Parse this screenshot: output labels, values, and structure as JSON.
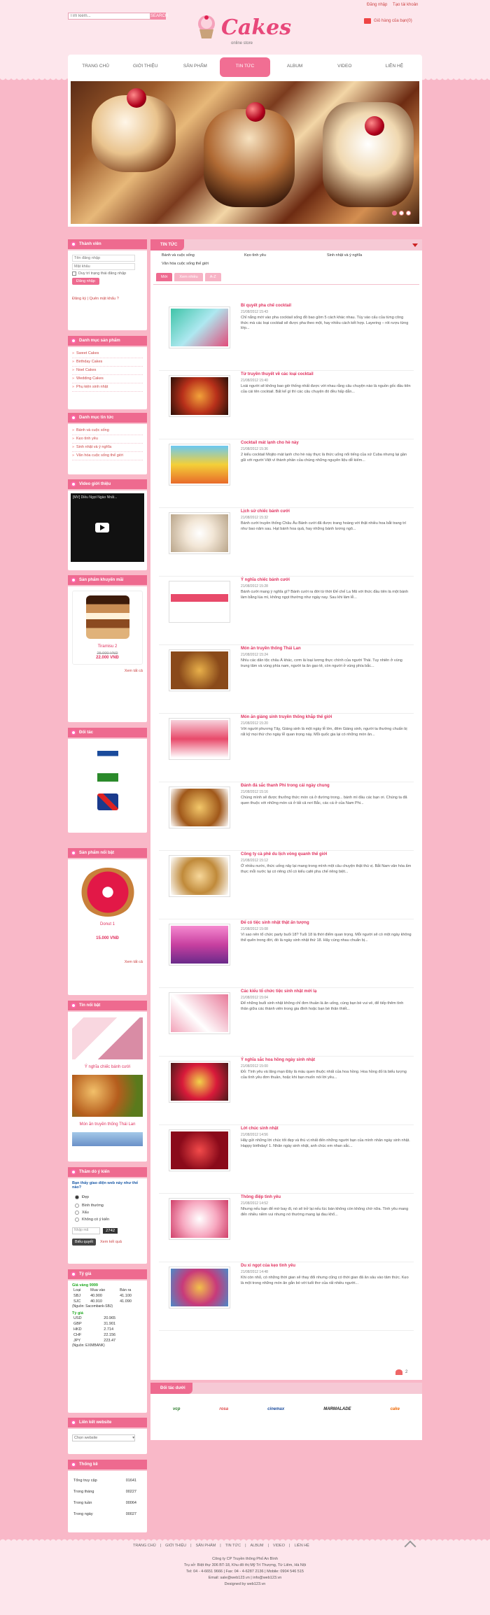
{
  "header": {
    "search_placeholder": "Tìm kiếm...",
    "search_button": "SEARCH",
    "login_link": "Đăng nhập",
    "register_link": "Tạo tài khoản",
    "cart_text": "Giỏ hàng của bạn(0)",
    "logo_word": "Cakes",
    "logo_sub": "online store"
  },
  "nav": [
    "TRANG CHỦ",
    "GIỚI THIỆU",
    "SẢN PHẨM",
    "TIN TỨC",
    "ALBUM",
    "VIDEO",
    "LIÊN HỆ"
  ],
  "nav_active": 3,
  "sidebar": {
    "login": {
      "title": "Thành viên",
      "username_ph": "Tên đăng nhập",
      "password_ph": "Mật khẩu",
      "remember": "Duy trì trạng thái đăng nhập",
      "button": "Đăng nhập",
      "links": "Đăng ký | Quên mật khẩu ?"
    },
    "products": {
      "title": "Danh mục sản phẩm",
      "items": [
        "Sweet Cakes",
        "Birthday Cakes",
        "Noel Cakes",
        "Wedding Cakes",
        "Phụ kiện sinh nhật"
      ]
    },
    "news": {
      "title": "Danh mục tin tức",
      "items": [
        "Bánh và cuộc sống",
        "Kẹo tình yêu",
        "Sinh nhật và ý nghĩa",
        "Văn hóa cuộc sống thế giới"
      ]
    },
    "video": {
      "title": "Video giới thiệu",
      "caption": "[MV] Diều Ngọt Ngào Nhất..."
    },
    "promo": {
      "title": "Sản phẩm khuyến mãi",
      "name": "Tiramisu 2",
      "old_price": "25.000 VNĐ",
      "new_price": "22.000 VNĐ",
      "more": "Xem tất cả"
    },
    "partners_title": "Đối tác",
    "featured": {
      "title": "Sản phẩm nổi bật",
      "name": "Donut 1",
      "price": "15.000 VNĐ",
      "more": "Xem tất cả"
    },
    "featured_news": {
      "title": "Tin nổi bật",
      "items": [
        "Ý nghĩa chiếc bánh cưới",
        "Món ăn truyền thống Thái Lan"
      ]
    },
    "poll": {
      "title": "Thăm dò ý kiến",
      "question": "Bạn thấy giao diện web này như thế nào?",
      "options": [
        "Đẹp",
        "Bình thường",
        "Xấu",
        "Không có ý kiến"
      ],
      "selected": 0,
      "code_label": "Nhập mã",
      "code": "2742",
      "vote_button": "Biểu quyết",
      "result_link": "Xem kết quả"
    },
    "rates": {
      "title": "Tỷ giá",
      "gold_label": "Giá vàng 9999",
      "gold_cols": [
        "Loại",
        "Mua vào",
        "Bán ra"
      ],
      "gold_rows": [
        [
          "SBJ",
          "40.900",
          "41.100"
        ],
        [
          "SJC",
          "40.910",
          "41.090"
        ]
      ],
      "gold_source": "(Nguồn: Sacombank-SBJ)",
      "fx_label": "Tỷ giá",
      "fx_rows": [
        [
          "USD",
          "20.965"
        ],
        [
          "GBP",
          "31.901"
        ],
        [
          "HKD",
          "2.714"
        ],
        [
          "CHF",
          "22.156"
        ],
        [
          "JPY",
          "223.47"
        ]
      ],
      "fx_source": "(Nguồn: EXIMBANK)"
    },
    "weblinks": {
      "title": "Liên kết website",
      "select": "Chọn website"
    },
    "stats": {
      "title": "Thống kê",
      "rows": [
        [
          "Tổng truy cập",
          "01641"
        ],
        [
          "Trong tháng",
          "00227"
        ],
        [
          "Trong tuần",
          "00064"
        ],
        [
          "Trong ngày",
          "00027"
        ]
      ]
    }
  },
  "main": {
    "title": "TIN TỨC",
    "cats": [
      "Bánh và cuộc sống",
      "Kẹo tình yêu",
      "Sinh nhật và ý nghĩa",
      "Văn hóa cuộc sống thế giới"
    ],
    "tabs": [
      "Mới",
      "Xem nhiều",
      "A-Z"
    ],
    "articles": [
      {
        "title": "Bí quyết pha chế cocktail",
        "date": "21/08/2012 15:43",
        "excerpt": "Chỉ nắng mới vào pha cocktail sống đồ bao gồm 5 cách khác nhau. Tùy vào cấu của từng công thức mà các loại cocktail sẽ được pha theo một, hay nhiều cách kết hợp. Layering – rót rượu từng lớp..."
      },
      {
        "title": "Từ truyền thuyết về các loại cocktail",
        "date": "21/08/2012 15:40",
        "excerpt": "Loài người sẽ không bao giờ thống nhất được với nhau rằng câu chuyện nào là nguồn gốc đầu tiên của cái tên cocktail. Bất kể gì thì các câu chuyện đó đều hấp dẫn..."
      },
      {
        "title": "Cocktail mát lạnh cho hè này",
        "date": "21/08/2012 15:36",
        "excerpt": "2 kiểu cocktail Mojito mát lạnh cho hè này thực là thức uống nổi tiếng của xứ Cuba nhưng lại gần gũi với người Việt vì thành phần của chúng những nguyên liệu dễ kiếm..."
      },
      {
        "title": "Lịch sử chiếc bánh cưới",
        "date": "21/08/2012 15:32",
        "excerpt": "Bánh cưới truyền thống Châu Âu Bánh cưới đã được trang hoàng với thật nhiều hoa bắt trang trí như bao năm sau. Hạt bánh hoa quả, hay những bánh lương ngô..."
      },
      {
        "title": "Ý nghĩa chiếc bánh cưới",
        "date": "21/08/2012 15:28",
        "excerpt": "Bánh cưới mang ý nghĩa gì? Bánh cưới ra đời từ thời Đế chế La Mã với thức đầu tiên là một bánh làm bằng lúa mì, không ngọt thường như ngày nay. Sau khi làm lễ..."
      },
      {
        "title": "Món ăn truyền thống Thái Lan",
        "date": "21/08/2012 15:24",
        "excerpt": "Nhìu các dân tộc châu Á khác, cơm là loại lương thực chính của người Thái. Tuy nhiên ở vùng trung tâm và vùng phía nam, người ta ăn gạo tẻ, còn người ở vùng phía bắc..."
      },
      {
        "title": "Món ăn giáng sinh truyền thống khắp thế giới",
        "date": "21/08/2012 15:20",
        "excerpt": "Với người phương Tây, Giáng sinh là một ngày lễ lớn, đêm Giáng sinh, người ta thường chuẩn bị rất kỹ mọi thứ cho ngày lễ quan trọng này. Mỗi quốc gia lại có những món ăn..."
      },
      {
        "title": "Đánh đá sắc thanh Phi trong cái ngày chung",
        "date": "21/08/2012 15:16",
        "excerpt": "Chúng mình sẽ được thưởng thức món cá ở đường trong... bánh mì đầu các bạn ơi. Chúng ta đã quen thuộc với những món cá ở tất cả nơi Bắc, các cá ở của Nam Phi..."
      },
      {
        "title": "Công ty cà phê du lịch vòng quanh thế giới",
        "date": "21/08/2012 15:12",
        "excerpt": "Ở nhiều nước, thức uống nây lại mang trong mình một câu chuyện thật thú vị. Bắt Nam văn hóa ẩm thực mỗi nước lại có riêng chỉ có kiểu café pha chế riêng biệt..."
      },
      {
        "title": "Để có tiệc sinh nhật thật ấn tượng",
        "date": "21/08/2012 15:08",
        "excerpt": "Vì sao nên tổ chức party buổi 18? Tuổi 18 là thời điểm quan trọng. Mỗi người sẽ có một ngày không thể quên trong đời, đó là ngày sinh nhật thứ 18. Hãy cùng nhau chuẩn bị..."
      },
      {
        "title": "Các kiểu tổ chức tiệc sinh nhật mới lạ",
        "date": "21/08/2012 15:04",
        "excerpt": "Để những buổi sinh nhật không chỉ đơn thuần là ăn uống, cùng bạn bè vui vẻ, để tiếp thêm tình thân giữa các thành viên trong gia đình hoặc bạn bè thân thiết..."
      },
      {
        "title": "Ý nghĩa sắc hoa hồng ngày sinh nhật",
        "date": "21/08/2012 15:00",
        "excerpt": "Đỏ: Tình yêu và lãng mạn Đây là màu quen thuộc nhất của hoa hồng. Hoa hồng đỏ là biểu tượng của tình yêu đơn thuần, hoặc khi bạn muốn nói lời yêu..."
      },
      {
        "title": "Lời chúc sinh nhật",
        "date": "21/08/2012 14:56",
        "excerpt": "Hãy gửi những lời chúc tốt đẹp và thú vị nhất đến những người bạn của mình nhân ngày sinh nhật. Happy birthday! 1. Nhân ngày sinh nhật, anh chúc em nhan sắc..."
      },
      {
        "title": "Thông điệp tình yêu",
        "date": "21/08/2012 14:52",
        "excerpt": "Nhưng nếu bạn để mờ bay đi, nó sẽ trở lại nếu lúc bán không còn không chờ nữa. Tình yêu mang đến nhiều niềm vui nhưng nó thường mang lại đau khổ..."
      },
      {
        "title": "Du xi ngọt của kẹo tình yêu",
        "date": "21/08/2012 14:48",
        "excerpt": "Khi còn nhỏ, có những thời gian sẽ thay đổi nhưng cũng có thời gian đã ăn sâu vào tâm thức. Kẹo là một trong những món ăn gắn bó với tuổi thơ của rất nhiều người..."
      }
    ],
    "pager": "2"
  },
  "partners_box": {
    "title": "Đối tác dưới",
    "logos": [
      "vcp",
      "rosa",
      "cinemax",
      "MARMALADE",
      "cake"
    ]
  },
  "footer": {
    "nav": [
      "TRANG CHỦ",
      "GIỚI THIỆU",
      "SẢN PHẨM",
      "TIN TỨC",
      "ALBUM",
      "VIDEO",
      "LIÊN HỆ"
    ],
    "company": "Công ty CP Truyền thông Phố An Bình",
    "address": "Trụ sở: Biệt thự 306 BT-18, Khu đô thị Mỹ Trì Thượng, Từ Liêm, Hà Nội",
    "phone": "Tel: 04 - 4-6651 9666 | Fax: 04 - 4-6287 2136 | Mobile: 0904 546 515",
    "email": "Email: sale@web123.vn | info@web123.vn",
    "design": "Designed by web123.vn"
  },
  "colors": {
    "accent": "#ee6a8f",
    "title": "#e0315e",
    "bg": "#f9b8c8"
  }
}
